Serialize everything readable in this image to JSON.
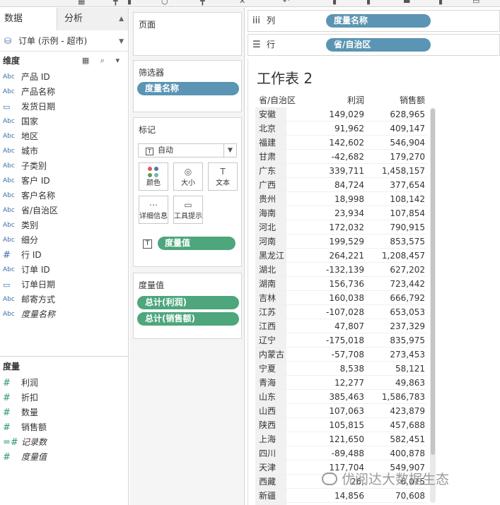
{
  "toolbar": {},
  "data_pane": {
    "tab_data": "数据",
    "tab_analysis": "分析",
    "datasource": "订单 (示例 - 超市)",
    "dimensions_header": "维度",
    "dimension_tools": "▦ ⌕ ▾",
    "dimensions": [
      {
        "type": "Abc",
        "name": "产品 ID"
      },
      {
        "type": "Abc",
        "name": "产品名称"
      },
      {
        "type": "date",
        "name": "发货日期"
      },
      {
        "type": "Abc",
        "name": "国家"
      },
      {
        "type": "Abc",
        "name": "地区"
      },
      {
        "type": "Abc",
        "name": "城市"
      },
      {
        "type": "Abc",
        "name": "子类别"
      },
      {
        "type": "Abc",
        "name": "客户 ID"
      },
      {
        "type": "Abc",
        "name": "客户名称"
      },
      {
        "type": "Abc",
        "name": "省/自治区"
      },
      {
        "type": "Abc",
        "name": "类别"
      },
      {
        "type": "Abc",
        "name": "细分"
      },
      {
        "type": "#",
        "name": "行 ID"
      },
      {
        "type": "Abc",
        "name": "订单 ID"
      },
      {
        "type": "date",
        "name": "订单日期"
      },
      {
        "type": "Abc",
        "name": "邮寄方式"
      },
      {
        "type": "Abc",
        "name": "度量名称",
        "italic": true
      }
    ],
    "measures_header": "度量",
    "measures": [
      {
        "type": "#",
        "name": "利润"
      },
      {
        "type": "#",
        "name": "折扣"
      },
      {
        "type": "#",
        "name": "数量"
      },
      {
        "type": "#",
        "name": "销售额"
      },
      {
        "type": "=#",
        "name": "记录数",
        "italic": true
      },
      {
        "type": "#",
        "name": "度量值",
        "italic": true
      }
    ]
  },
  "pages": {
    "title": "页面"
  },
  "filters": {
    "title": "筛选器",
    "pill": "度量名称"
  },
  "marks": {
    "title": "标记",
    "type_value": "自动",
    "buttons": {
      "color": "颜色",
      "size": "大小",
      "text": "文本",
      "detail": "详细信息",
      "tooltip": "工具提示"
    },
    "text_pill": "度量值"
  },
  "measure_values": {
    "title": "度量值",
    "pills": [
      "总计(利润)",
      "总计(销售额)"
    ]
  },
  "shelves": {
    "columns_label": "列",
    "columns_pill": "度量名称",
    "rows_label": "行",
    "rows_pill": "省/自治区"
  },
  "sheet": {
    "title": "工作表 2",
    "headers": [
      "省/自治区",
      "利润",
      "销售额"
    ],
    "rows": [
      [
        "安徽",
        "149,029",
        "628,965"
      ],
      [
        "北京",
        "91,962",
        "409,147"
      ],
      [
        "福建",
        "142,602",
        "546,904"
      ],
      [
        "甘肃",
        "-42,682",
        "179,270"
      ],
      [
        "广东",
        "339,711",
        "1,458,157"
      ],
      [
        "广西",
        "84,724",
        "377,654"
      ],
      [
        "贵州",
        "18,998",
        "108,142"
      ],
      [
        "海南",
        "23,934",
        "107,854"
      ],
      [
        "河北",
        "172,032",
        "790,915"
      ],
      [
        "河南",
        "199,529",
        "853,575"
      ],
      [
        "黑龙江",
        "264,221",
        "1,208,457"
      ],
      [
        "湖北",
        "-132,139",
        "627,202"
      ],
      [
        "湖南",
        "156,736",
        "723,442"
      ],
      [
        "吉林",
        "160,038",
        "666,792"
      ],
      [
        "江苏",
        "-107,028",
        "653,053"
      ],
      [
        "江西",
        "47,807",
        "237,329"
      ],
      [
        "辽宁",
        "-175,018",
        "835,975"
      ],
      [
        "内蒙古",
        "-57,708",
        "273,453"
      ],
      [
        "宁夏",
        "8,538",
        "58,121"
      ],
      [
        "青海",
        "12,277",
        "49,863"
      ],
      [
        "山东",
        "385,463",
        "1,586,783"
      ],
      [
        "山西",
        "107,063",
        "423,879"
      ],
      [
        "陕西",
        "105,815",
        "457,688"
      ],
      [
        "上海",
        "121,650",
        "582,451"
      ],
      [
        "四川",
        "-89,488",
        "400,878"
      ],
      [
        "天津",
        "117,704",
        "549,907"
      ],
      [
        "西藏",
        "26,",
        "6,015"
      ],
      [
        "新疆",
        "14,856",
        "70,608"
      ]
    ]
  },
  "watermark": "优阅达大数据生态"
}
